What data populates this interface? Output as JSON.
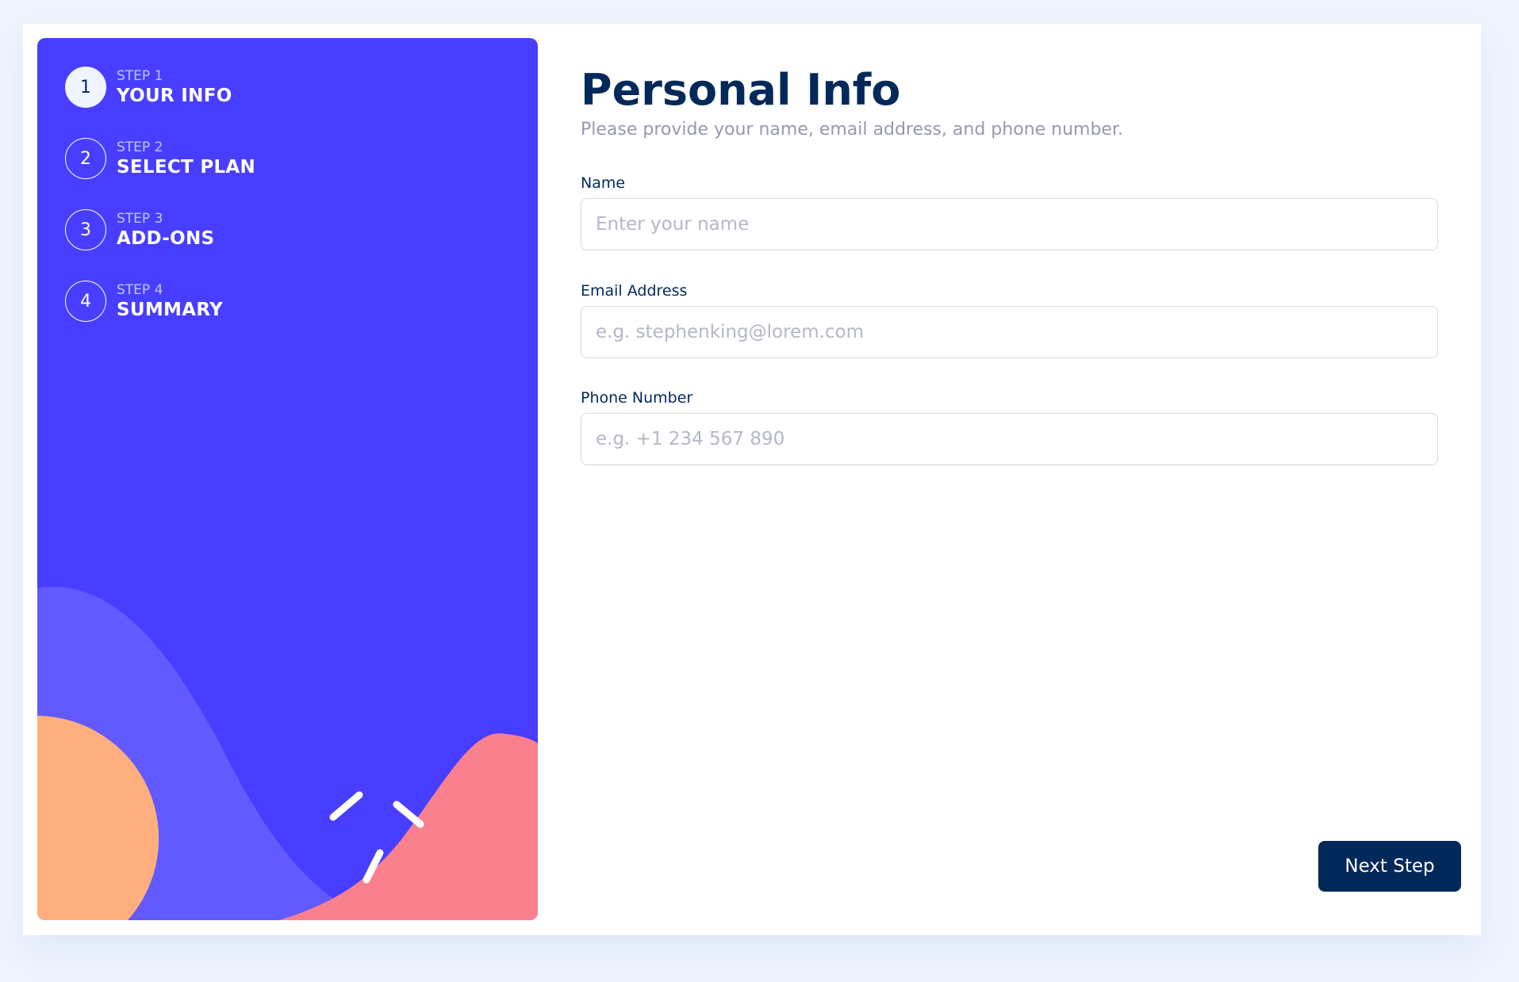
{
  "sidebar": {
    "steps": [
      {
        "number": "1",
        "label": "STEP 1",
        "title": "YOUR INFO",
        "active": true
      },
      {
        "number": "2",
        "label": "STEP 2",
        "title": "SELECT PLAN",
        "active": false
      },
      {
        "number": "3",
        "label": "STEP 3",
        "title": "ADD-ONS",
        "active": false
      },
      {
        "number": "4",
        "label": "STEP 4",
        "title": "SUMMARY",
        "active": false
      }
    ]
  },
  "main": {
    "title": "Personal Info",
    "subtitle": "Please provide your name, email address, and phone number.",
    "fields": {
      "name": {
        "label": "Name",
        "value": "",
        "placeholder": "Enter your name"
      },
      "email": {
        "label": "Email Address",
        "value": "",
        "placeholder": "e.g. stephenking@lorem.com"
      },
      "phone": {
        "label": "Phone Number",
        "value": "",
        "placeholder": "e.g. +1 234 567 890"
      }
    },
    "next_label": "Next Step"
  },
  "colors": {
    "sidebar_bg": "#483eff",
    "title": "#02295a",
    "button_bg": "#02295a",
    "page_bg": "#eff5fe",
    "decor_orange": "#ffaf7e",
    "decor_pink": "#f9818e",
    "decor_violet": "#6259ff"
  }
}
